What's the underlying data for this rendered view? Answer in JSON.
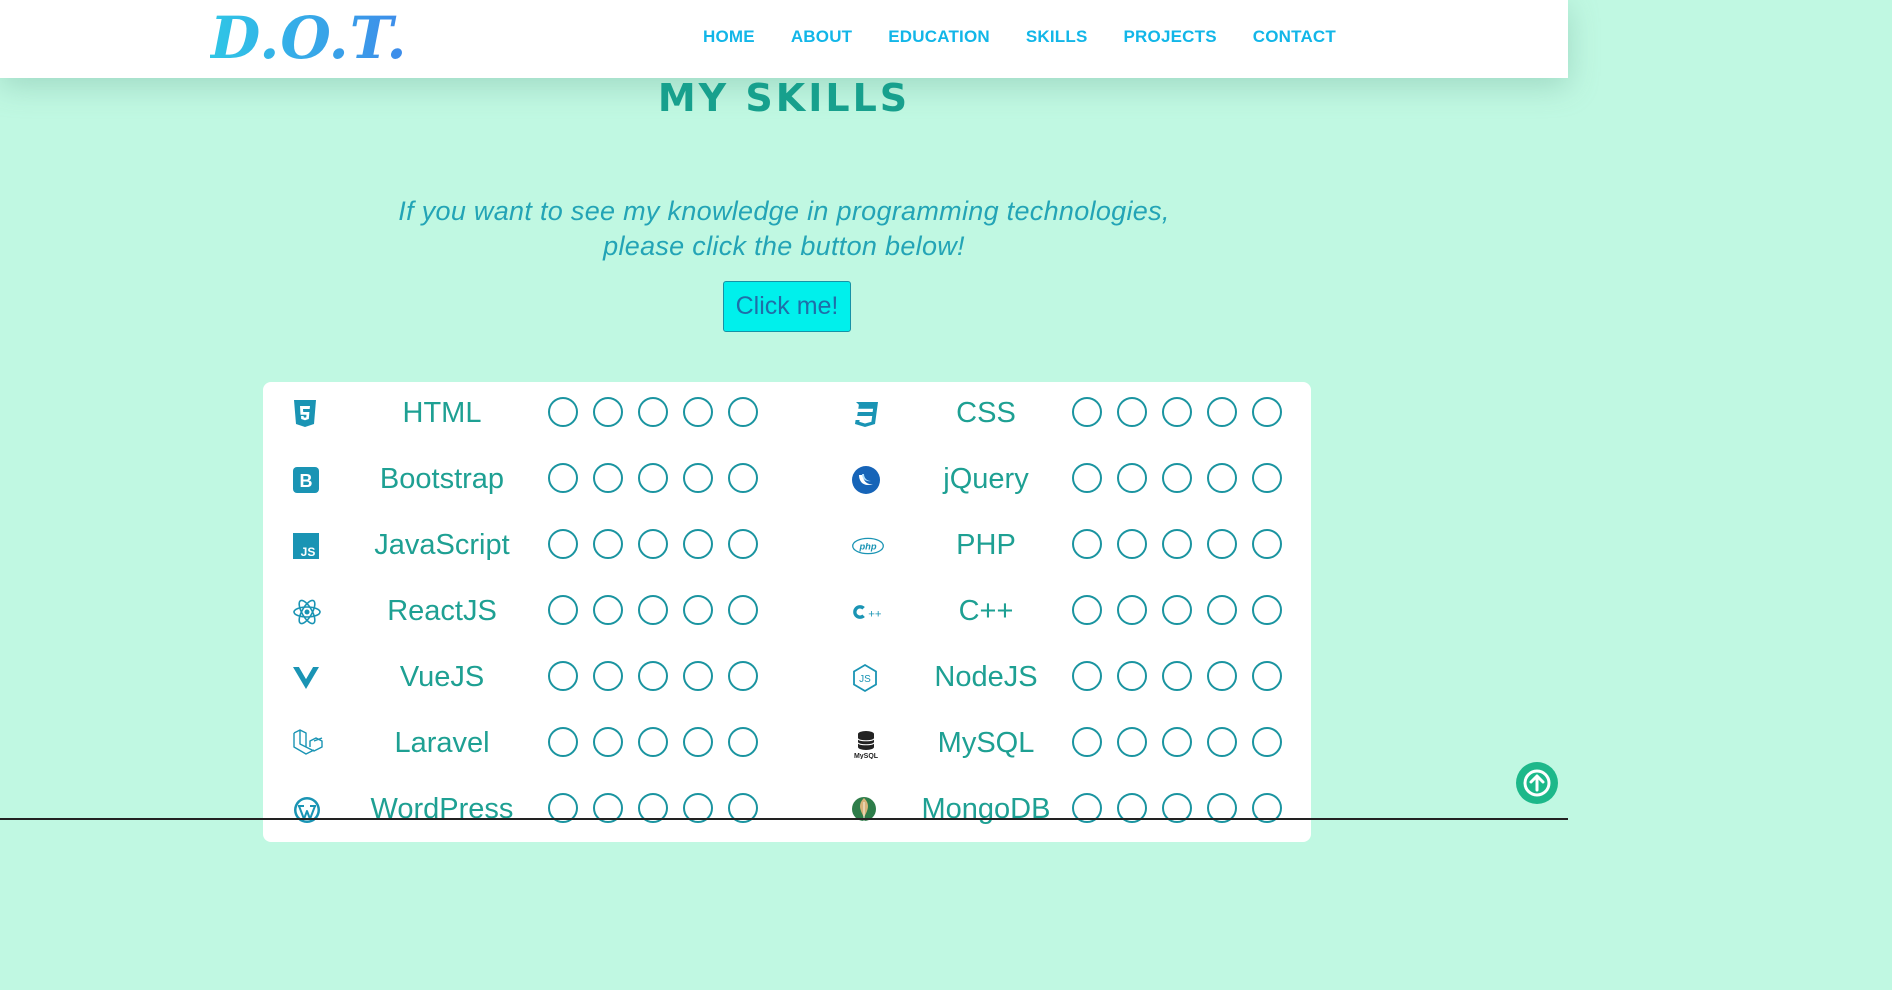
{
  "brand": {
    "logo": "D.O.T."
  },
  "nav": {
    "items": [
      "HOME",
      "ABOUT",
      "EDUCATION",
      "SKILLS",
      "PROJECTS",
      "CONTACT"
    ]
  },
  "skills_section": {
    "title": "MY SKILLS",
    "intro_line1": "If you want to see my knowledge in programming technologies,",
    "intro_line2": "please click the button below!",
    "button_label": "Click me!"
  },
  "skills": {
    "left": [
      {
        "name": "HTML",
        "icon": "html5-icon"
      },
      {
        "name": "Bootstrap",
        "icon": "bootstrap-icon"
      },
      {
        "name": "JavaScript",
        "icon": "javascript-icon"
      },
      {
        "name": "ReactJS",
        "icon": "react-icon"
      },
      {
        "name": "VueJS",
        "icon": "vue-icon"
      },
      {
        "name": "Laravel",
        "icon": "laravel-icon"
      },
      {
        "name": "WordPress",
        "icon": "wordpress-icon"
      }
    ],
    "right": [
      {
        "name": "CSS",
        "icon": "css3-icon"
      },
      {
        "name": "jQuery",
        "icon": "jquery-icon"
      },
      {
        "name": "PHP",
        "icon": "php-icon"
      },
      {
        "name": "C++",
        "icon": "cplusplus-icon"
      },
      {
        "name": "NodeJS",
        "icon": "nodejs-icon"
      },
      {
        "name": "MySQL",
        "icon": "mysql-icon"
      },
      {
        "name": "MongoDB",
        "icon": "mongodb-icon"
      }
    ],
    "rating_max": 5,
    "rating_filled": 0
  },
  "colors": {
    "page_bg": "#c0f8e2",
    "accent": "#1ea093",
    "nav_link": "#12b6e8",
    "button_bg": "#00f0ec",
    "scroll_top": "#1db88a"
  }
}
